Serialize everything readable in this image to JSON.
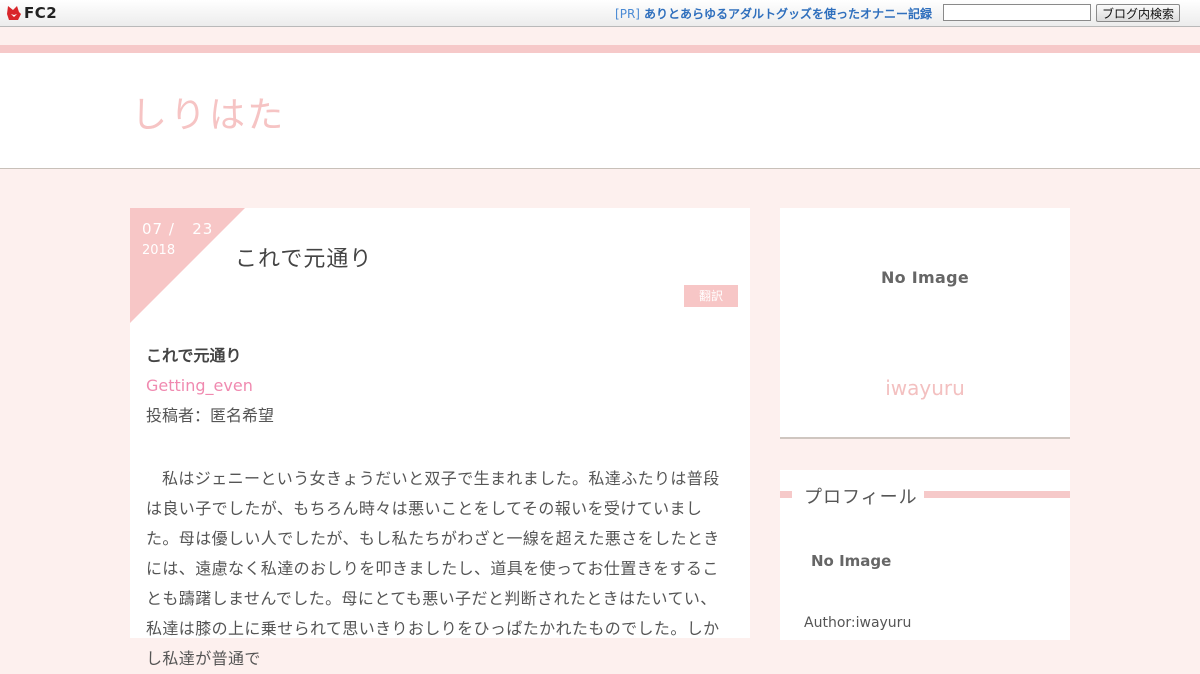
{
  "fc2bar": {
    "logo_text": "FC2",
    "pr_tag": "[PR]",
    "pr_text": "ありとあらゆるアダルトグッズを使ったオナニー記録",
    "search_placeholder": "",
    "search_button": "ブログ内検索"
  },
  "blog": {
    "title": "しりはた"
  },
  "article": {
    "date_month": "07",
    "date_day": "23",
    "date_year": "2018",
    "date_sep": "/",
    "title": "これで元通り",
    "category": "翻訳",
    "sub_title": "これで元通り",
    "original_title": "Getting_even",
    "poster": "投稿者：匿名希望",
    "paragraph": "私はジェニーという女きょうだいと双子で生まれました。私達ふたりは普段は良い子でしたが、もちろん時々は悪いことをしてその報いを受けていました。母は優しい人でしたが、もし私たちがわざと一線を超えた悪さをしたときには、遠慮なく私達のおしりを叩きましたし、道具を使ってお仕置きをすることも躊躇しませんでした。母にとても悪い子だと判断されたときはたいてい、私達は膝の上に乗せられて思いきりおしりをひっぱたかれたものでした。しかし私達が普通で"
  },
  "sidebar": {
    "noimage_label": "No Image",
    "author_name": "iwayuru",
    "profile_title": "プロフィール",
    "profile_noimage": "No Image",
    "author_line": "Author:iwayuru"
  },
  "colors": {
    "accent_pink": "#f6c9c9",
    "title_pink": "#f6c4c4",
    "link_blue": "#2f6fbd",
    "original_pink": "#f08ab0",
    "page_bg": "#fdf0ee"
  }
}
